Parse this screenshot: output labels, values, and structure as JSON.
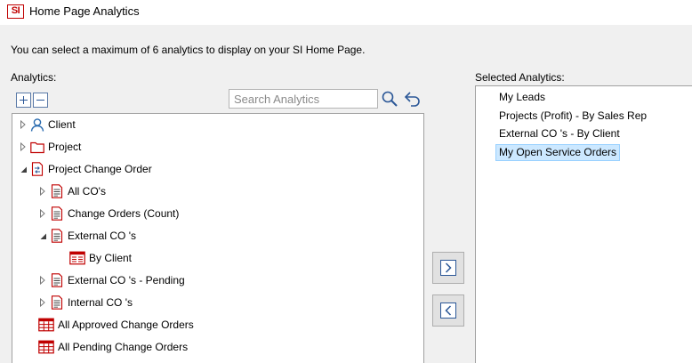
{
  "window": {
    "title": "Home Page Analytics",
    "logo_text": "SI"
  },
  "instruction": "You can select a maximum of 6 analytics to display on your SI Home Page.",
  "analytics": {
    "label": "Analytics:",
    "search_placeholder": "Search Analytics",
    "tree": [
      {
        "label": "Client",
        "icon": "person-icon",
        "state": "collapsed",
        "level": 0
      },
      {
        "label": "Project",
        "icon": "folder-icon",
        "state": "collapsed",
        "level": 0
      },
      {
        "label": "Project Change Order",
        "icon": "change-order-icon",
        "state": "expanded",
        "level": 0
      },
      {
        "label": "All CO's",
        "icon": "document-icon",
        "state": "collapsed",
        "level": 1
      },
      {
        "label": "Change Orders (Count)",
        "icon": "document-icon",
        "state": "collapsed",
        "level": 1
      },
      {
        "label": "External CO 's",
        "icon": "document-icon",
        "state": "expanded",
        "level": 1
      },
      {
        "label": "By Client",
        "icon": "report-icon",
        "state": "leaf",
        "level": 2
      },
      {
        "label": "External CO 's - Pending",
        "icon": "document-icon",
        "state": "collapsed",
        "level": 1
      },
      {
        "label": "Internal CO 's",
        "icon": "document-icon",
        "state": "collapsed",
        "level": 1
      },
      {
        "label": "All Approved Change Orders",
        "icon": "table-icon",
        "state": "leaf",
        "level": 1
      },
      {
        "label": "All Pending Change Orders",
        "icon": "table-icon",
        "state": "leaf",
        "level": 1
      }
    ]
  },
  "selected": {
    "label": "Selected Analytics:",
    "items": [
      {
        "label": "My Leads",
        "selected": false
      },
      {
        "label": "Projects (Profit) - By Sales Rep",
        "selected": false
      },
      {
        "label": "External CO 's - By Client",
        "selected": false
      },
      {
        "label": "My Open Service Orders",
        "selected": true
      }
    ]
  },
  "colors": {
    "accent": "#2b5797",
    "brand": "#c00000",
    "selection": "#cce8ff"
  }
}
